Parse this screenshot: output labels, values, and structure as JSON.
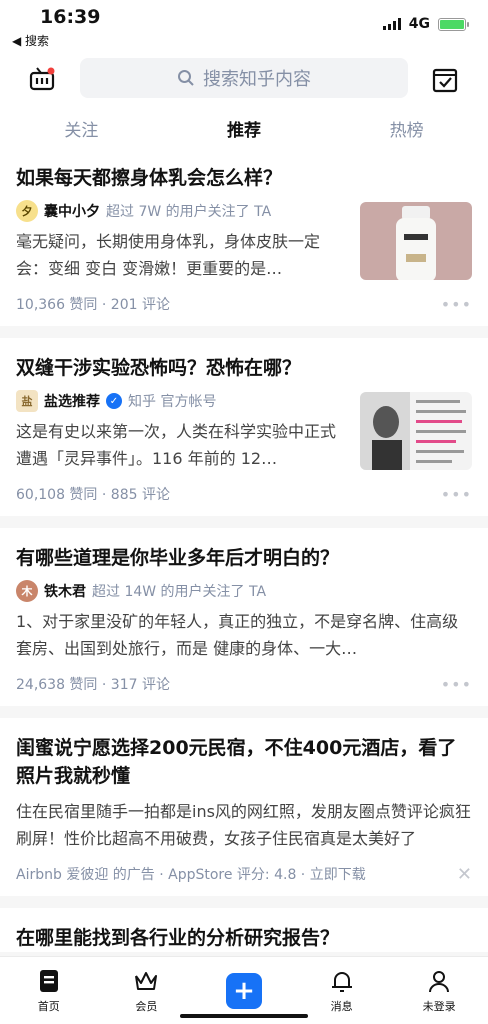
{
  "status": {
    "time": "16:39",
    "back_label": "◀ 搜索",
    "network": "4G"
  },
  "header": {
    "search_placeholder": "搜索知乎内容"
  },
  "tabs": [
    {
      "label": "关注",
      "active": false
    },
    {
      "label": "推荐",
      "active": true
    },
    {
      "label": "热榜",
      "active": false
    }
  ],
  "cards": [
    {
      "title": "如果每天都擦身体乳会怎么样？",
      "author": "囊中小夕",
      "note": "超过 7W 的用户关注了 TA",
      "excerpt": "毫无疑问，长期使用身体乳，身体皮肤一定会：变细 变白 变滑嫩！更重要的是…",
      "stats": "10,366 赞同 · 201 评论"
    },
    {
      "title": "双缝干涉实验恐怖吗？恐怖在哪？",
      "author": "盐选推荐",
      "note": "知乎 官方帐号",
      "excerpt": "这是有史以来第一次，人类在科学实验中正式遭遇「灵异事件」。116 年前的 12…",
      "stats": "60,108 赞同 · 885 评论"
    },
    {
      "title": "有哪些道理是你毕业多年后才明白的？",
      "author": "铁木君",
      "note": "超过 14W 的用户关注了 TA",
      "excerpt": "1、对于家里没矿的年轻人，真正的独立，不是穿名牌、住高级套房、出国到处旅行，而是 健康的身体、一大…",
      "stats": "24,638 赞同 · 317 评论"
    }
  ],
  "ad": {
    "title": "闺蜜说宁愿选择200元民宿，不住400元酒店，看了照片我就秒懂",
    "text": "住在民宿里随手一拍都是ins风的网红照，发朋友圈点赞评论疯狂刷屏！性价比超高不用破费，女孩子住民宿真是太美好了",
    "meta": "Airbnb 爱彼迎 的广告 · AppStore 评分: 4.8 · 立即下载"
  },
  "partial_card": {
    "title": "在哪里能找到各行业的分析研究报告？"
  },
  "nav": [
    {
      "label": "首页",
      "icon": "home-icon"
    },
    {
      "label": "会员",
      "icon": "crown-icon"
    },
    {
      "label": "",
      "icon": "plus-icon"
    },
    {
      "label": "消息",
      "icon": "bell-icon"
    },
    {
      "label": "未登录",
      "icon": "user-icon"
    }
  ],
  "colors": {
    "accent": "#1772f6",
    "muted": "#8590a6",
    "text": "#121212"
  }
}
